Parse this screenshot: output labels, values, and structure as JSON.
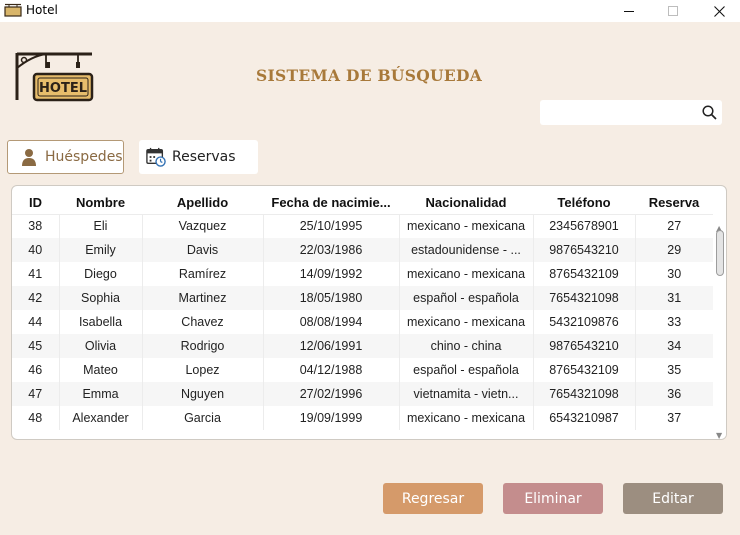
{
  "window": {
    "title": "Hotel"
  },
  "colors": {
    "accent_gold": "#a8793a",
    "regresar": "#d59a6a",
    "eliminar": "#c48d8d",
    "editar": "#9c8e80",
    "background": "#f6ede4"
  },
  "header": {
    "logo_text": "HOTEL",
    "title": "SISTEMA DE BÚSQUEDA"
  },
  "search": {
    "value": "",
    "placeholder": ""
  },
  "tabs": [
    {
      "label": "Huéspedes",
      "icon": "user-icon",
      "active": true
    },
    {
      "label": "Reservas",
      "icon": "calendar-clock-icon",
      "active": false
    }
  ],
  "table": {
    "columns": [
      "ID",
      "Nombre",
      "Apellido",
      "Fecha de nacimie...",
      "Nacionalidad",
      "Teléfono",
      "Reserva"
    ],
    "rows": [
      [
        "38",
        "Eli",
        "Vazquez",
        "25/10/1995",
        "mexicano - mexicana",
        "2345678901",
        "27"
      ],
      [
        "40",
        "Emily",
        "Davis",
        "22/03/1986",
        "estadounidense - ...",
        "9876543210",
        "29"
      ],
      [
        "41",
        "Diego",
        "Ramírez",
        "14/09/1992",
        "mexicano - mexicana",
        "8765432109",
        "30"
      ],
      [
        "42",
        "Sophia",
        "Martinez",
        "18/05/1980",
        "español - española",
        "7654321098",
        "31"
      ],
      [
        "44",
        "Isabella",
        "Chavez",
        "08/08/1994",
        "mexicano - mexicana",
        "5432109876",
        "33"
      ],
      [
        "45",
        "Olivia",
        "Rodrigo",
        "12/06/1991",
        "chino - china",
        "9876543210",
        "34"
      ],
      [
        "46",
        "Mateo",
        "Lopez",
        "04/12/1988",
        "español - española",
        "8765432109",
        "35"
      ],
      [
        "47",
        "Emma",
        "Nguyen",
        "27/02/1996",
        "vietnamita - vietn...",
        "7654321098",
        "36"
      ],
      [
        "48",
        "Alexander",
        "Garcia",
        "19/09/1999",
        "mexicano - mexicana",
        "6543210987",
        "37"
      ]
    ]
  },
  "buttons": {
    "regresar": "Regresar",
    "eliminar": "Eliminar",
    "editar": "Editar"
  }
}
